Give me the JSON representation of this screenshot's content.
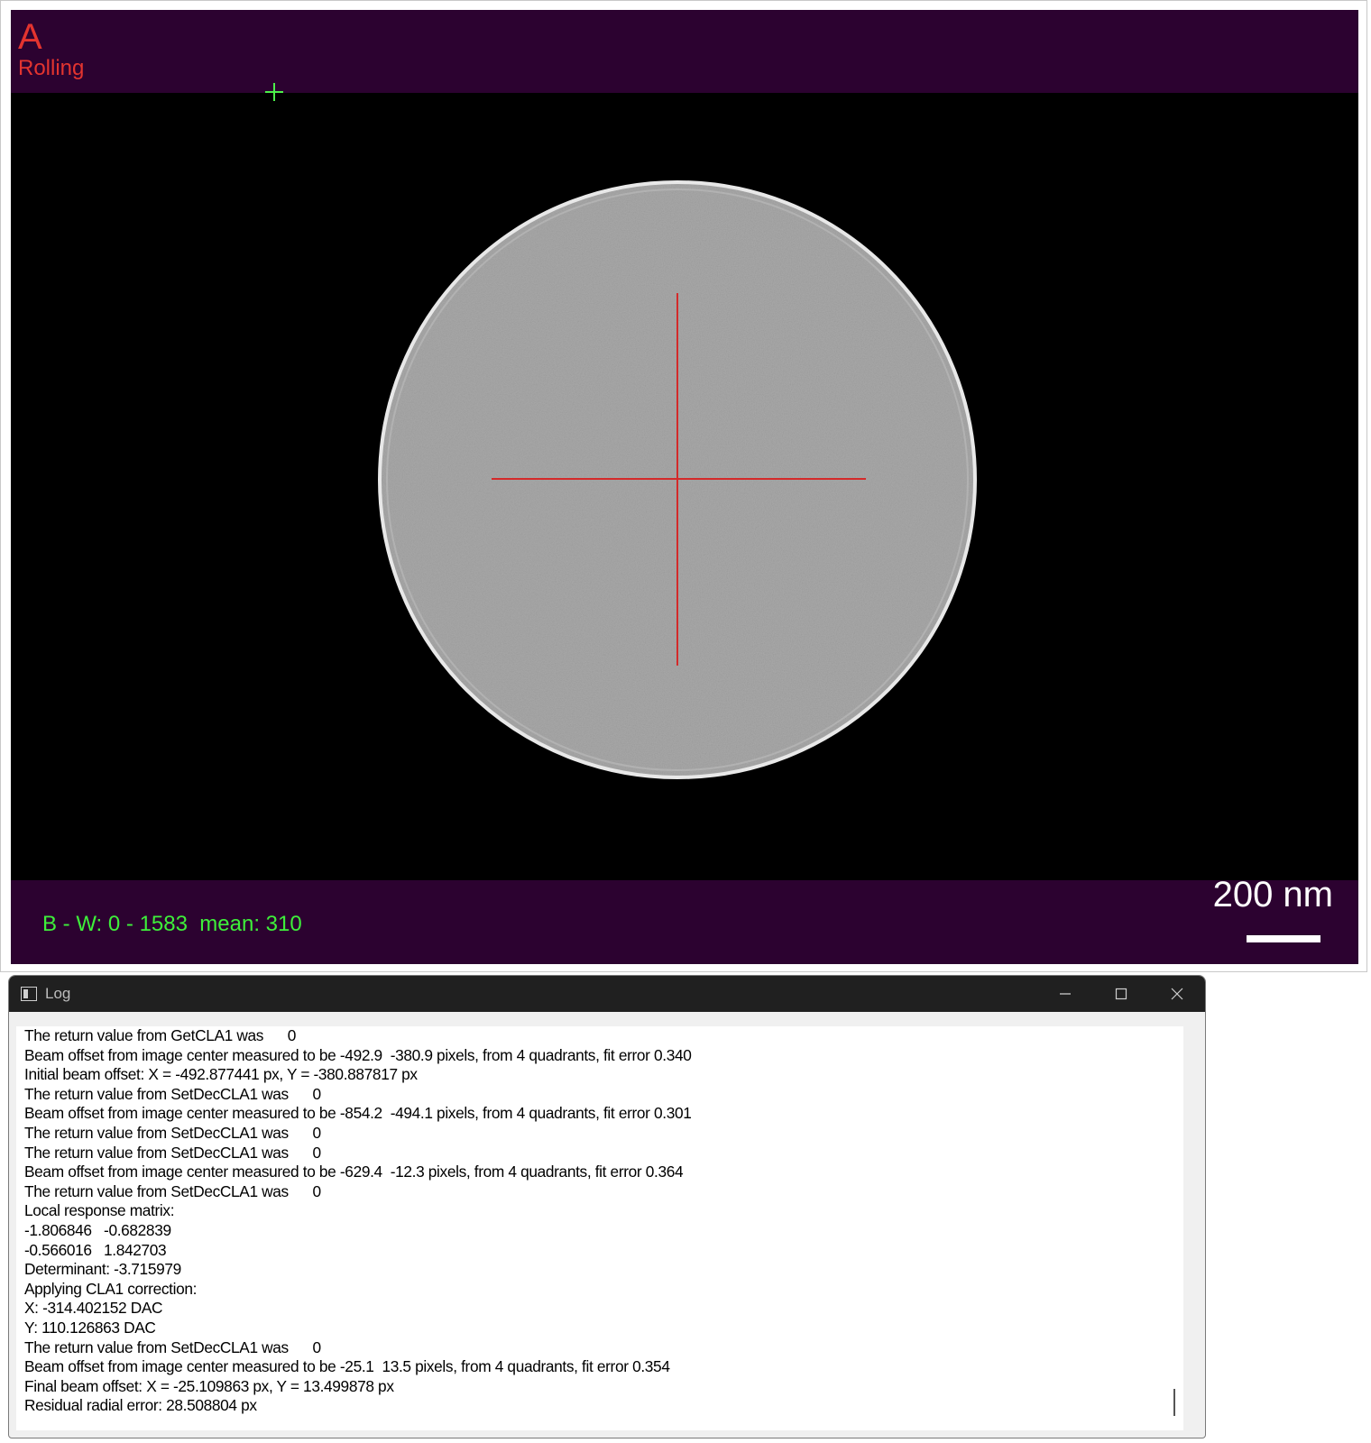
{
  "viewer": {
    "label_letter": "A",
    "label_mode": "Rolling",
    "stats_text": "B - W: 0 - 1583  mean: 310",
    "scale_label": "200 nm",
    "colors": {
      "band": "#2c0230",
      "label": "#e3342f",
      "stats": "#3ef03a",
      "crosshair": "#d42a2a",
      "small_cross": "#4cf04a",
      "specimen_fill": "#a9a9a9"
    },
    "icons": [
      "crosshair-icon",
      "small-cross-marker-icon"
    ]
  },
  "log": {
    "title": "Log",
    "icons": [
      "app-icon",
      "minimize-icon",
      "maximize-icon",
      "close-icon"
    ],
    "lines": [
      "The return value from GetCLA1 was      0",
      "Beam offset from image center measured to be -492.9  -380.9 pixels, from 4 quadrants, fit error 0.340",
      "Initial beam offset: X = -492.877441 px, Y = -380.887817 px",
      "The return value from SetDecCLA1 was      0",
      "Beam offset from image center measured to be -854.2  -494.1 pixels, from 4 quadrants, fit error 0.301",
      "The return value from SetDecCLA1 was      0",
      "The return value from SetDecCLA1 was      0",
      "Beam offset from image center measured to be -629.4  -12.3 pixels, from 4 quadrants, fit error 0.364",
      "The return value from SetDecCLA1 was      0",
      "Local response matrix:",
      "-1.806846   -0.682839",
      "-0.566016   1.842703",
      "Determinant: -3.715979",
      "Applying CLA1 correction:",
      "X: -314.402152 DAC",
      "Y: 110.126863 DAC",
      "The return value from SetDecCLA1 was      0",
      "Beam offset from image center measured to be -25.1  13.5 pixels, from 4 quadrants, fit error 0.354",
      "Final beam offset: X = -25.109863 px, Y = 13.499878 px",
      "Residual radial error: 28.508804 px"
    ]
  }
}
